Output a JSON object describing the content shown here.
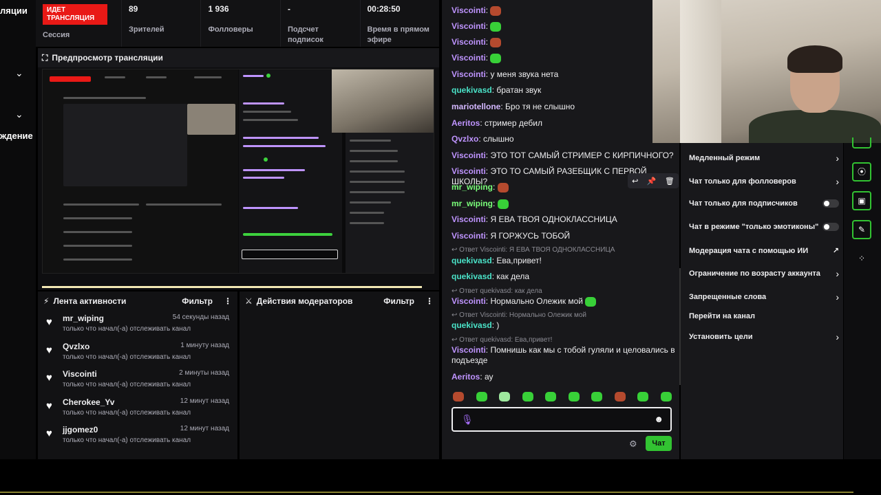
{
  "nav": {
    "label_1": "ляции",
    "label_2": "ждение"
  },
  "stats": {
    "live_badge": "ИДЕТ ТРАНСЛЯЦИЯ",
    "session": "Сессия",
    "viewers_value": "89",
    "viewers_label": "Зрителей",
    "followers_value": "1 936",
    "followers_label": "Фолловеры",
    "subs_value": "-",
    "subs_label": "Подсчет подписок",
    "uptime_value": "00:28:50",
    "uptime_label": "Время в прямом эфире"
  },
  "preview": {
    "title": "Предпросмотр трансляции"
  },
  "activity": {
    "title": "Лента активности",
    "filter": "Фильтр",
    "items": [
      {
        "user": "mr_wiping",
        "time": "54 секунды назад",
        "desc": "только что начал(-а) отслеживать канал"
      },
      {
        "user": "Qvzlxo",
        "time": "1 минуту назад",
        "desc": "только что начал(-а) отслеживать канал"
      },
      {
        "user": "Viscointi",
        "time": "2 минуты назад",
        "desc": "только что начал(-а) отслеживать канал"
      },
      {
        "user": "Cherokee_Yv",
        "time": "12 минут назад",
        "desc": "только что начал(-а) отслеживать канал"
      },
      {
        "user": "jjgomez0",
        "time": "12 минут назад",
        "desc": "только что начал(-а) отслеживать канал"
      }
    ]
  },
  "mod_actions": {
    "title": "Действия модераторов",
    "filter": "Фильтр"
  },
  "chat": {
    "messages": [
      {
        "user": "Viscointi",
        "color": "#bf94ff",
        "text": ""
      },
      {
        "user": "Viscointi",
        "color": "#bf94ff",
        "text": ""
      },
      {
        "user": "Viscointi",
        "color": "#bf94ff",
        "text": ""
      },
      {
        "user": "Viscointi",
        "color": "#bf94ff",
        "text": ""
      },
      {
        "user": "Viscointi",
        "color": "#bf94ff",
        "text": "у меня звука нета"
      },
      {
        "user": "quekivasd",
        "color": "#4ae3c8",
        "text": "братан звук"
      },
      {
        "user": "mariotellone",
        "color": "#d4b8ff",
        "text": "Бро тя не слышно"
      },
      {
        "user": "Aeritos",
        "color": "#bf94ff",
        "text": "стример дебил"
      },
      {
        "user": "Qvzlxo",
        "color": "#bf94ff",
        "text": "слышно"
      },
      {
        "user": "Viscointi",
        "color": "#bf94ff",
        "text": "ЭТО ТОТ САМЫЙ СТРИМЕР С КИРПИЧНОГО?"
      },
      {
        "user": "Viscointi",
        "color": "#bf94ff",
        "text": "ЭТО ТО САМЫЙ РАЗЕБЩИК С ПЕРВОЙ ШКОЛЫ?"
      },
      {
        "user": "mr_wiping",
        "color": "#7aff7a",
        "text": ""
      },
      {
        "user": "mr_wiping",
        "color": "#7aff7a",
        "text": ""
      },
      {
        "user": "Viscointi",
        "color": "#bf94ff",
        "text": "Я ЕВА ТВОЯ ОДНОКЛАССНИЦА"
      },
      {
        "user": "Viscointi",
        "color": "#bf94ff",
        "text": "Я ГОРЖУСЬ ТОБОЙ"
      },
      {
        "user": "quekivasd",
        "color": "#4ae3c8",
        "text": "Ева,привет!"
      },
      {
        "user": "quekivasd",
        "color": "#4ae3c8",
        "text": "как дела"
      },
      {
        "user": "Viscointi",
        "color": "#bf94ff",
        "text": "Нормально Олежик мой"
      },
      {
        "user": "quekivasd",
        "color": "#4ae3c8",
        "text": ")"
      },
      {
        "user": "Viscointi",
        "color": "#bf94ff",
        "text": "Помнишь как мы с тобой гуляли и целовались в подъезде"
      },
      {
        "user": "Aeritos",
        "color": "#bf94ff",
        "text": "ау"
      }
    ],
    "replies": [
      "Ответ Viscointi: Я ЕВА ТВОЯ ОДНОКЛАССНИЦА",
      "Ответ quekivasd: как дела",
      "Ответ Viscointi: Нормально Олежик мой",
      "Ответ quekivasd: Ева,привет!"
    ],
    "send_label": "Чат"
  },
  "mod_menu": {
    "slow_mode": "Медленный режим",
    "followers_only": "Чат только для фолловеров",
    "subs_only": "Чат только для подписчиков",
    "emote_only": "Чат в режиме \"только эмотиконы\"",
    "ai_moderation": "Модерация чата с помощью ИИ",
    "age_restriction": "Ограничение по возрасту аккаунта",
    "banned_words": "Запрещенные слова",
    "go_to_channel": "Перейти на канал",
    "set_goals": "Установить цели"
  }
}
